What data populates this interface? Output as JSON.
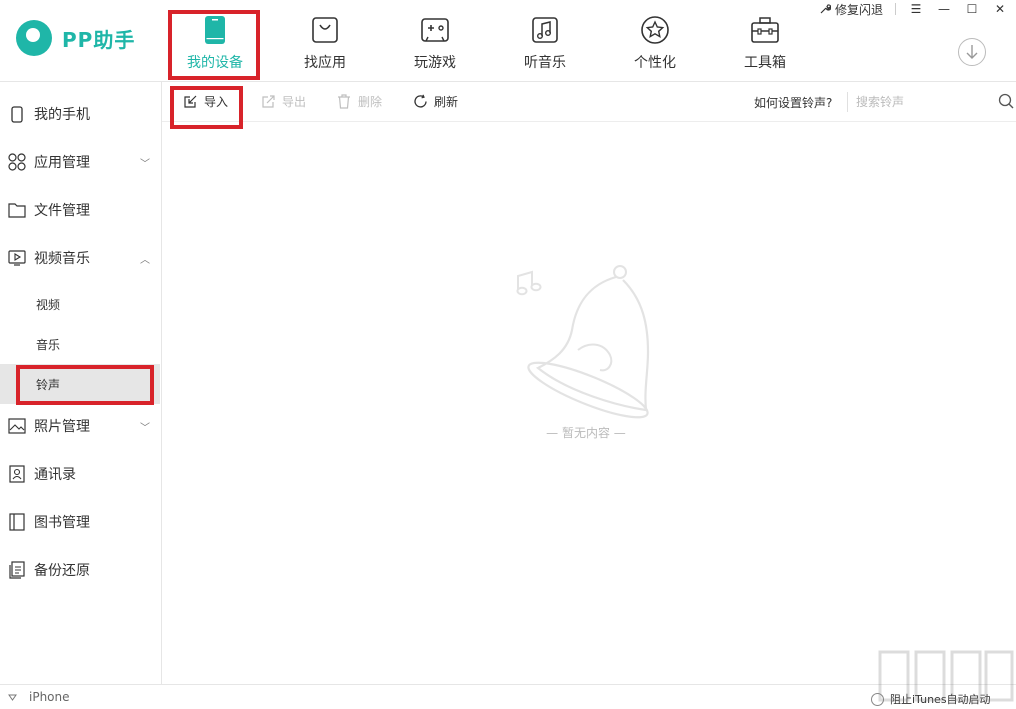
{
  "app": {
    "name": "PP助手"
  },
  "nav": [
    {
      "label": "我的设备",
      "icon": "phone-icon",
      "active": true
    },
    {
      "label": "找应用",
      "icon": "bag-icon"
    },
    {
      "label": "玩游戏",
      "icon": "gamepad-icon"
    },
    {
      "label": "听音乐",
      "icon": "music-note-icon"
    },
    {
      "label": "个性化",
      "icon": "star-icon"
    },
    {
      "label": "工具箱",
      "icon": "toolbox-icon"
    }
  ],
  "window": {
    "repair_label": "修复闪退"
  },
  "sidebar": {
    "items": [
      {
        "label": "我的手机",
        "icon": "phone-outline-icon"
      },
      {
        "label": "应用管理",
        "icon": "apps-grid-icon"
      },
      {
        "label": "文件管理",
        "icon": "folder-icon"
      },
      {
        "label": "视频音乐",
        "icon": "media-icon"
      },
      {
        "label": "照片管理",
        "icon": "photo-icon"
      },
      {
        "label": "通讯录",
        "icon": "contacts-icon"
      },
      {
        "label": "图书管理",
        "icon": "book-icon"
      },
      {
        "label": "备份还原",
        "icon": "backup-icon"
      }
    ],
    "media_sub": [
      {
        "label": "视频"
      },
      {
        "label": "音乐"
      },
      {
        "label": "铃声",
        "active": true
      }
    ]
  },
  "toolbar": {
    "import_label": "导入",
    "export_label": "导出",
    "delete_label": "删除",
    "refresh_label": "刷新",
    "help_link": "如何设置铃声?",
    "search_placeholder": "搜索铃声"
  },
  "empty": {
    "text": "— 暂无内容 —"
  },
  "status": {
    "device": "iPhone",
    "itunes_label": "阻止iTunes自动启动"
  },
  "colors": {
    "accent": "#1fb6a8",
    "highlight": "#d8232a"
  }
}
